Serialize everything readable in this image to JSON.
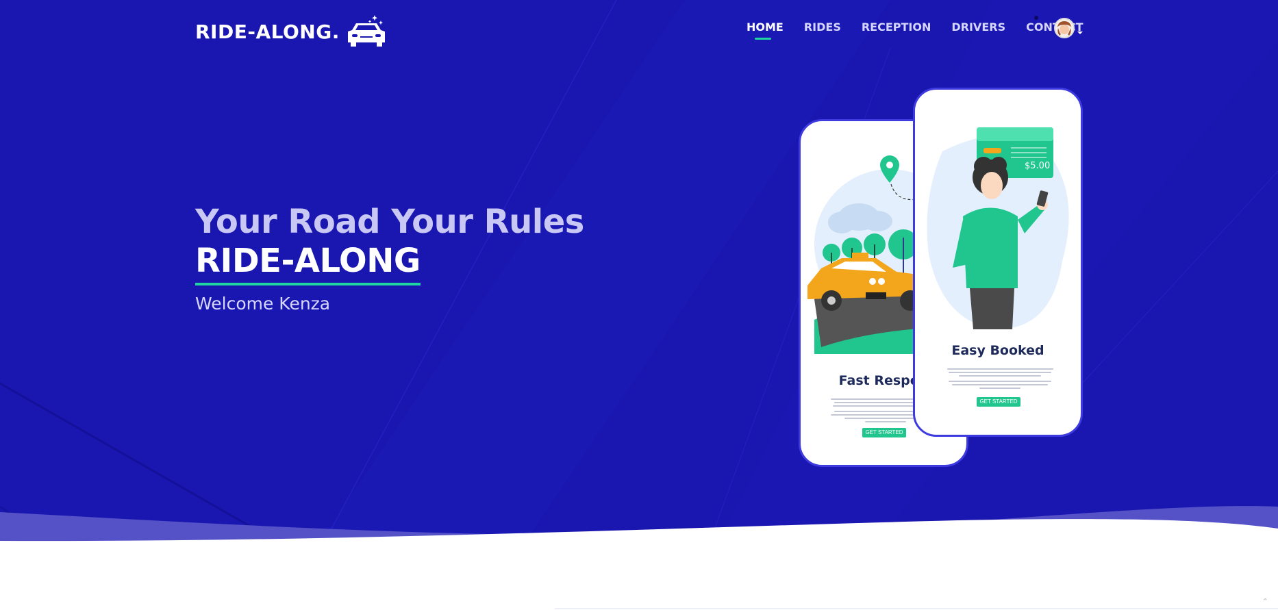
{
  "brand": {
    "name": "RIDE-ALONG."
  },
  "nav": {
    "items": [
      {
        "label": "HOME",
        "active": true
      },
      {
        "label": "RIDES",
        "active": false
      },
      {
        "label": "RECEPTION",
        "active": false
      },
      {
        "label": "DRIVERS",
        "active": false
      },
      {
        "label": "CONTACT",
        "active": false
      }
    ]
  },
  "hero": {
    "tagline": "Your Road Your Rules",
    "title": "RIDE-ALONG",
    "welcome": "Welcome Kenza"
  },
  "phones": [
    {
      "title": "Fast Respon",
      "button": "GET STARTED"
    },
    {
      "title": "Easy Booked",
      "button": "GET STARTED",
      "price": "$5.00"
    }
  ],
  "colors": {
    "background": "#1a17b0",
    "accent": "#20d6a0",
    "phone_border": "#3d3ae0"
  },
  "icons": [
    "car-logo-icon",
    "avatar",
    "caret-down-icon",
    "location-pin-icon",
    "scroll-up-icon"
  ]
}
